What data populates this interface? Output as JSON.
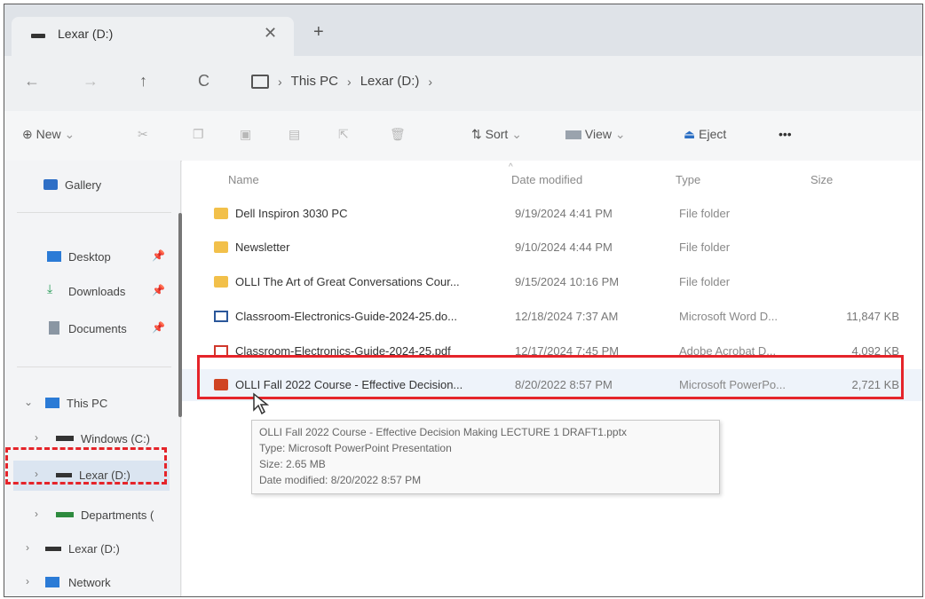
{
  "tab": {
    "title": "Lexar (D:)",
    "close": "✕",
    "new_tab": "+"
  },
  "address": {
    "back": "←",
    "forward": "→",
    "up": "↑",
    "refresh": "C",
    "crumbs": [
      "This PC",
      "Lexar (D:)"
    ],
    "sep": "›"
  },
  "commands": {
    "new": "New",
    "sort": "Sort",
    "view": "View",
    "eject": "Eject",
    "more": "•••",
    "new_icon": "⊕",
    "sort_icon": "⇅"
  },
  "nav": {
    "gallery": "Gallery",
    "desktop": "Desktop",
    "downloads": "Downloads",
    "documents": "Documents",
    "this_pc": "This PC",
    "windows": "Windows (C:)",
    "lexar": "Lexar (D:)",
    "departments": "Departments (",
    "lexar2": "Lexar (D:)",
    "network": "Network",
    "pin": "📌",
    "expand": "›",
    "expanded": "⌄"
  },
  "columns": {
    "name": "Name",
    "date": "Date modified",
    "type": "Type",
    "size": "Size"
  },
  "files": [
    {
      "name": "Dell Inspiron 3030 PC",
      "date": "9/19/2024 4:41 PM",
      "type": "File folder",
      "size": "",
      "icon": "folder-icon"
    },
    {
      "name": "Newsletter",
      "date": "9/10/2024 4:44 PM",
      "type": "File folder",
      "size": "",
      "icon": "folder-icon"
    },
    {
      "name": "OLLI The Art of Great Conversations Cour...",
      "date": "9/15/2024 10:16 PM",
      "type": "File folder",
      "size": "",
      "icon": "folder-icon"
    },
    {
      "name": "Classroom-Electronics-Guide-2024-25.do...",
      "date": "12/18/2024 7:37 AM",
      "type": "Microsoft Word D...",
      "size": "11,847 KB",
      "icon": "word-icon"
    },
    {
      "name": "Classroom-Electronics-Guide-2024-25.pdf",
      "date": "12/17/2024 7:45 PM",
      "type": "Adobe Acrobat D...",
      "size": "4,092 KB",
      "icon": "pdf-icon"
    },
    {
      "name": "OLLI Fall 2022 Course - Effective Decision...",
      "date": "8/20/2022 8:57 PM",
      "type": "Microsoft PowerPo...",
      "size": "2,721 KB",
      "icon": "powerpoint-icon"
    }
  ],
  "tooltip": {
    "line1": "OLLI Fall 2022 Course - Effective Decision Making LECTURE 1 DRAFT1.pptx",
    "line2": "Type: Microsoft PowerPoint Presentation",
    "line3": "Size: 2.65 MB",
    "line4": "Date modified: 8/20/2022 8:57 PM"
  },
  "colors": {
    "highlight": "#e5242a",
    "folder": "#f2c04a",
    "word": "#2b579a",
    "pdf": "#d0382c",
    "powerpoint": "#d04423",
    "nav_selected": "#dbe5f1"
  }
}
